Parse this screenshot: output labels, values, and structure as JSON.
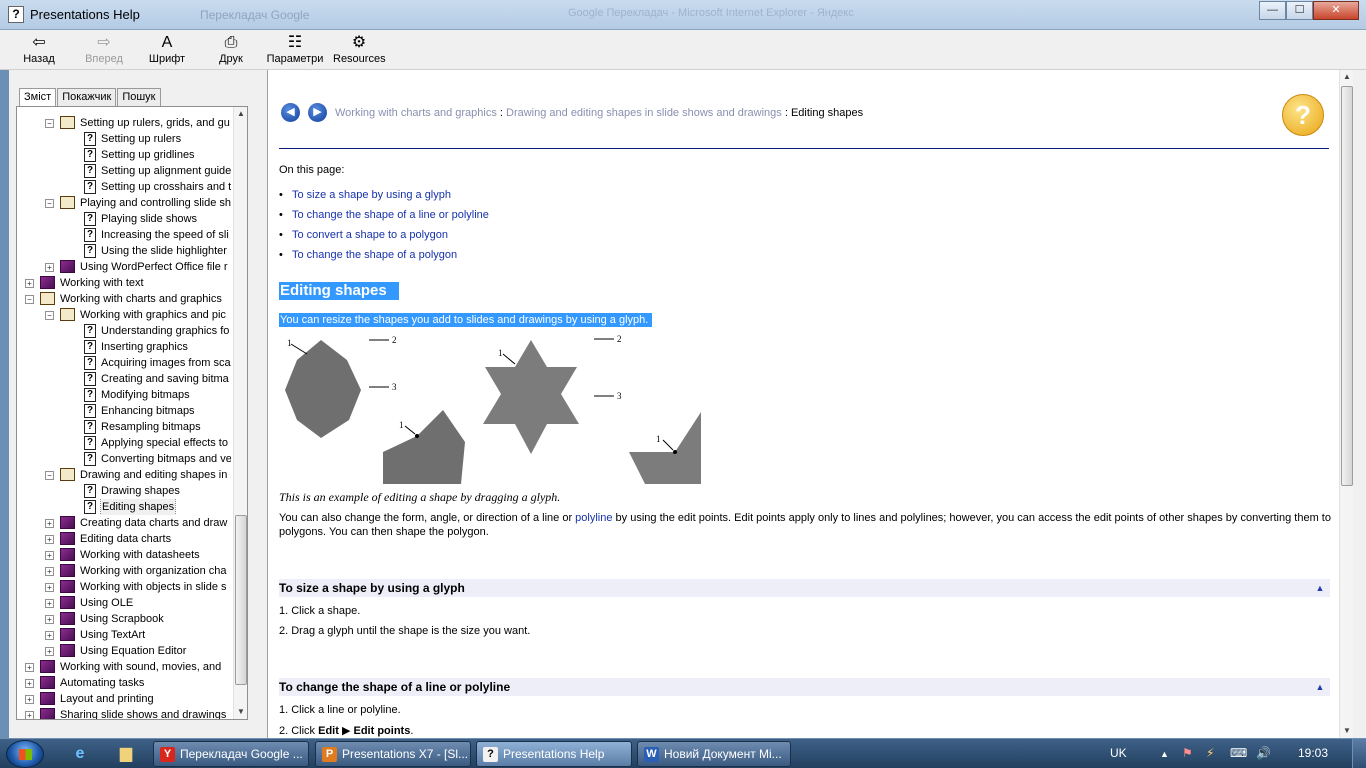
{
  "window": {
    "title": "Presentations Help",
    "background_tab": "Перекладач Google",
    "background_title": "Google Перекладач - Microsoft Internet Explorer - Яндекс",
    "minimize_glyph": "—",
    "maximize_glyph": "☐",
    "close_glyph": "✕",
    "app_glyph": "?"
  },
  "toolbar": {
    "back_label": "Назад",
    "forward_label": "Вперед",
    "font_label": "Шрифт",
    "print_label": "Друк",
    "options_label": "Параметри",
    "resources_label": "Resources",
    "back_icon": "⇦",
    "forward_icon": "⇨",
    "font_icon": "A",
    "print_icon": "⎙",
    "options_icon": "☷",
    "resources_icon": "⚙"
  },
  "tabs": [
    "Зміст",
    "Покажчик",
    "Пошук"
  ],
  "tree": [
    {
      "level": 2,
      "type": "book-open",
      "exp": "−",
      "label": "Setting up rulers, grids, and gu"
    },
    {
      "level": 3,
      "type": "page",
      "label": "Setting up rulers"
    },
    {
      "level": 3,
      "type": "page",
      "label": "Setting up gridlines"
    },
    {
      "level": 3,
      "type": "page",
      "label": "Setting up alignment guide"
    },
    {
      "level": 3,
      "type": "page",
      "label": "Setting up crosshairs and t"
    },
    {
      "level": 2,
      "type": "book-open",
      "exp": "−",
      "label": "Playing and controlling slide sh"
    },
    {
      "level": 3,
      "type": "page",
      "label": "Playing slide shows"
    },
    {
      "level": 3,
      "type": "page",
      "label": "Increasing the speed of sli"
    },
    {
      "level": 3,
      "type": "page",
      "label": "Using the slide highlighter"
    },
    {
      "level": 2,
      "type": "book",
      "exp": "+",
      "label": "Using WordPerfect Office file r"
    },
    {
      "level": 1,
      "type": "book",
      "exp": "+",
      "label": "Working with text"
    },
    {
      "level": 1,
      "type": "book-open",
      "exp": "−",
      "label": "Working with charts and graphics"
    },
    {
      "level": 2,
      "type": "book-open",
      "exp": "−",
      "label": "Working with graphics and pic"
    },
    {
      "level": 3,
      "type": "page",
      "label": "Understanding graphics fo"
    },
    {
      "level": 3,
      "type": "page",
      "label": "Inserting graphics"
    },
    {
      "level": 3,
      "type": "page",
      "label": "Acquiring images from sca"
    },
    {
      "level": 3,
      "type": "page",
      "label": "Creating and saving bitma"
    },
    {
      "level": 3,
      "type": "page",
      "label": "Modifying bitmaps"
    },
    {
      "level": 3,
      "type": "page",
      "label": "Enhancing bitmaps"
    },
    {
      "level": 3,
      "type": "page",
      "label": "Resampling bitmaps"
    },
    {
      "level": 3,
      "type": "page",
      "label": "Applying special effects to"
    },
    {
      "level": 3,
      "type": "page",
      "label": "Converting bitmaps and ve"
    },
    {
      "level": 2,
      "type": "book-open",
      "exp": "−",
      "label": "Drawing and editing shapes in"
    },
    {
      "level": 3,
      "type": "page",
      "label": "Drawing shapes"
    },
    {
      "level": 3,
      "type": "page",
      "label": "Editing shapes",
      "selected": true
    },
    {
      "level": 2,
      "type": "book",
      "exp": "+",
      "label": "Creating data charts and draw"
    },
    {
      "level": 2,
      "type": "book",
      "exp": "+",
      "label": "Editing data charts"
    },
    {
      "level": 2,
      "type": "book",
      "exp": "+",
      "label": "Working with datasheets"
    },
    {
      "level": 2,
      "type": "book",
      "exp": "+",
      "label": "Working with organization cha"
    },
    {
      "level": 2,
      "type": "book",
      "exp": "+",
      "label": "Working with objects in slide s"
    },
    {
      "level": 2,
      "type": "book",
      "exp": "+",
      "label": "Using OLE"
    },
    {
      "level": 2,
      "type": "book",
      "exp": "+",
      "label": "Using Scrapbook"
    },
    {
      "level": 2,
      "type": "book",
      "exp": "+",
      "label": "Using TextArt"
    },
    {
      "level": 2,
      "type": "book",
      "exp": "+",
      "label": "Using Equation Editor"
    },
    {
      "level": 1,
      "type": "book",
      "exp": "+",
      "label": "Working with sound, movies, and"
    },
    {
      "level": 1,
      "type": "book",
      "exp": "+",
      "label": "Automating tasks"
    },
    {
      "level": 1,
      "type": "book",
      "exp": "+",
      "label": "Layout and printing"
    },
    {
      "level": 1,
      "type": "book",
      "exp": "+",
      "label": "Sharing slide shows and drawings"
    }
  ],
  "content": {
    "breadcrumb_1": "Working with charts and graphics",
    "breadcrumb_2": "Drawing and editing shapes in slide shows and drawings",
    "breadcrumb_sep": " : ",
    "breadcrumb_current": "Editing shapes",
    "help_glyph": "?",
    "on_this_page": "On this page:",
    "toc": [
      "To size a shape by using a glyph",
      "To change the shape of a line or polyline",
      "To convert a shape to a polygon",
      "To change the shape of a polygon"
    ],
    "heading": "Editing shapes",
    "intro": "You can resize the shapes you add to slides and drawings by using a glyph.",
    "figure_labels": [
      "1",
      "2",
      "3",
      "1",
      "2",
      "3",
      "1",
      "1"
    ],
    "caption": "This is an example of editing a shape by dragging a glyph.",
    "para_1": "You can also change the form, angle, or direction of a line or ",
    "para_link": "polyline",
    "para_2": " by using the edit points. Edit points apply only to lines and polylines; however, you can access the edit points of other shapes by converting them to polygons. You can then shape the polygon.",
    "section_1_title": "To size a shape by using a glyph",
    "section_1_steps": [
      "1. Click a shape.",
      "2. Drag a glyph until the shape is the size you want."
    ],
    "section_2_title": "To change the shape of a line or polyline",
    "section_2_step1": "1. Click a line or polyline.",
    "section_2_step2_prefix": "2. Click ",
    "section_2_step2_menu": "Edit",
    "section_2_step2_item": "Edit points",
    "section_2_step2_suffix": ".",
    "up_glyph": "▲"
  },
  "taskbar": {
    "tasks": [
      {
        "label": "Перекладач Google ...",
        "icon": "Y",
        "icon_color": "#d8261c"
      },
      {
        "label": "Presentations X7 - [Sl...",
        "icon": "P",
        "icon_color": "#e07a1e"
      },
      {
        "label": "Presentations Help",
        "icon": "?",
        "icon_color": "#f2f2f2",
        "active": true
      },
      {
        "label": "Новий Документ Mi...",
        "icon": "W",
        "icon_color": "#2b5fb5"
      }
    ],
    "ie_icon": "e",
    "folder_icon": "▆",
    "lang": "UK",
    "clock": "19:03",
    "tray_icons": [
      "▲",
      "⚑",
      "⚡",
      "⌨",
      "🔊"
    ]
  }
}
